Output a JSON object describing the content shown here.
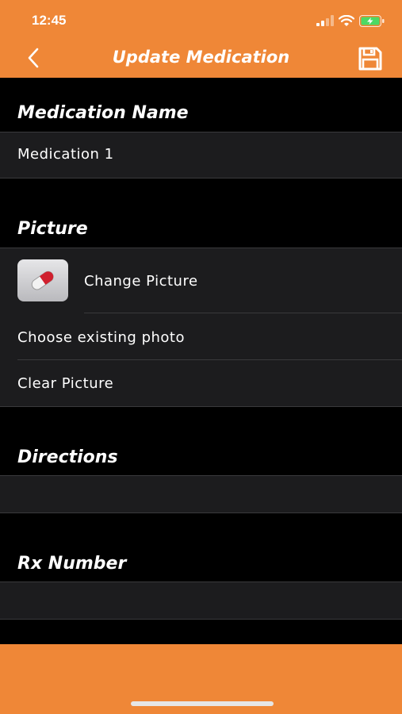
{
  "status_bar": {
    "time": "12:45"
  },
  "nav": {
    "title": "Update Medication",
    "back_icon": "chevron-left-icon",
    "save_icon": "floppy-disk-icon"
  },
  "sections": {
    "medication_name": {
      "header": "Medication Name",
      "value": "Medication 1"
    },
    "picture": {
      "header": "Picture",
      "change_label": "Change Picture",
      "choose_label": "Choose existing photo",
      "clear_label": "Clear Picture"
    },
    "directions": {
      "header": "Directions",
      "value": ""
    },
    "rx_number": {
      "header": "Rx Number",
      "value": ""
    }
  },
  "colors": {
    "accent": "#ef8737",
    "background": "#000000",
    "row": "#1c1c1e",
    "separator": "#3a3a3c"
  }
}
